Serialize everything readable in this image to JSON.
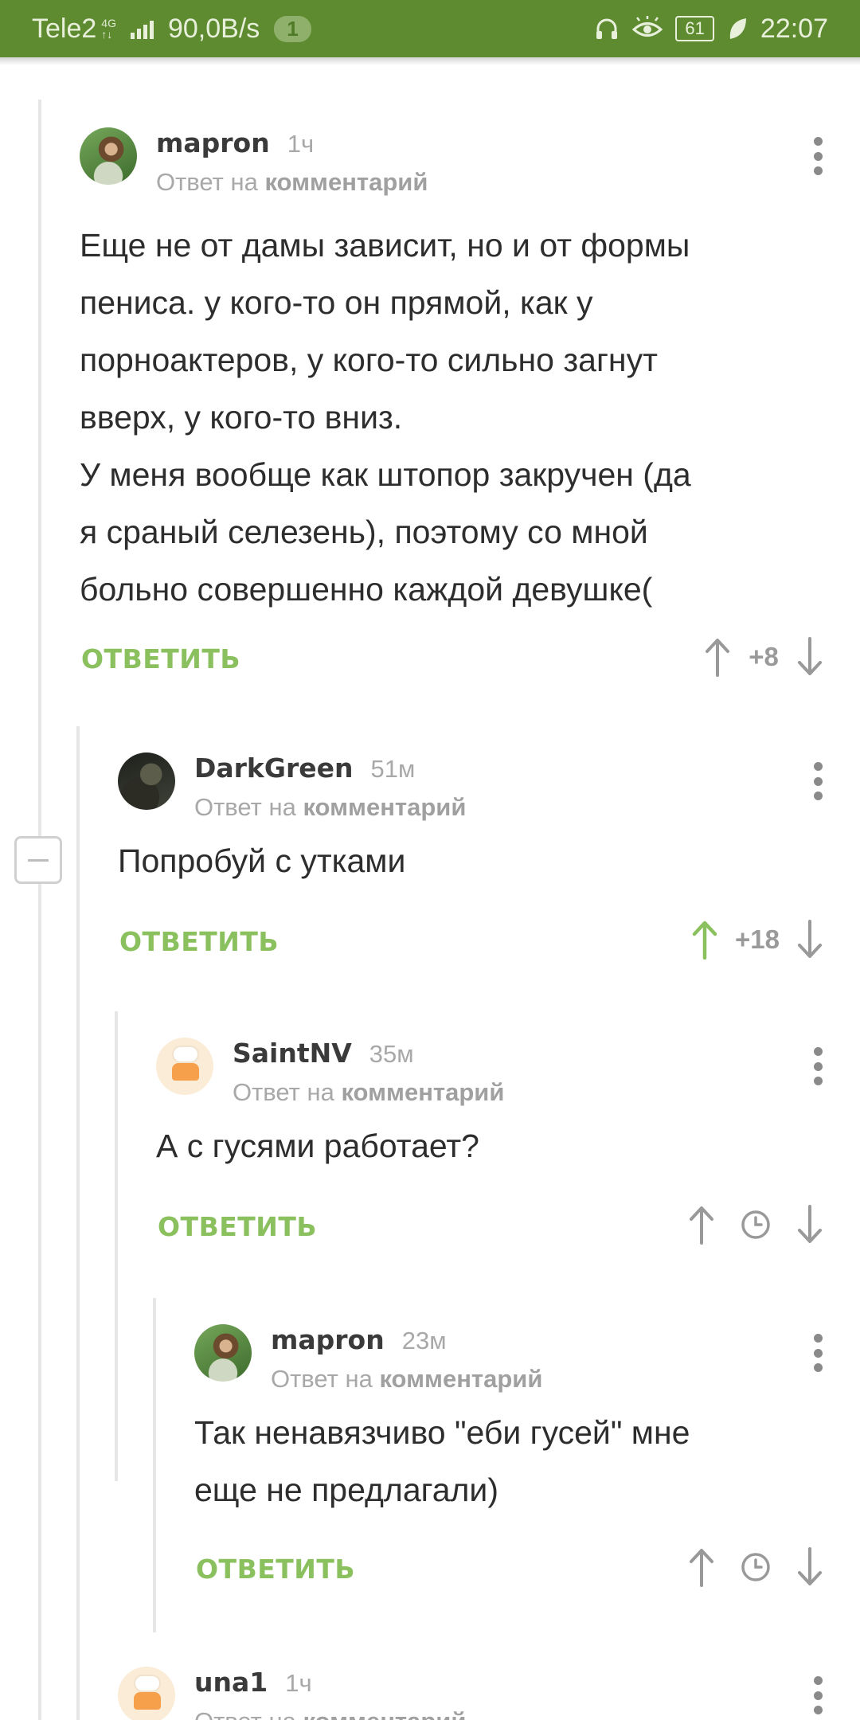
{
  "status_bar": {
    "carrier": "Tele2",
    "network_top": "4G",
    "network_bottom": "↑↓",
    "speed": "90,0B/s",
    "notifications": "1",
    "battery": "61",
    "time": "22:07",
    "bar_color": "#5e8b30"
  },
  "accent_color": "#8bc05f",
  "comments": [
    {
      "username": "mapron",
      "time": "1ч",
      "reply_prefix": "Ответ на",
      "reply_link": "комментарий",
      "body": [
        "Еще не от дамы зависит, но и от формы",
        "пениса. у кого-то он прямой, как у",
        "порноактеров, у кого-то сильно загнут",
        "вверх, у кого-то вниз.",
        "У меня вообще как штопор закручен (да",
        "я сраный селезень), поэтому со мной",
        "больно совершенно каждой девушке("
      ],
      "reply_label": "ОТВЕТИТЬ",
      "score": "+8"
    },
    {
      "username": "DarkGreen",
      "time": "51м",
      "reply_prefix": "Ответ на",
      "reply_link": "комментарий",
      "body": [
        "Попробуй с утками"
      ],
      "reply_label": "ОТВЕТИТЬ",
      "score": "+18",
      "upvoted": true
    },
    {
      "username": "SaintNV",
      "time": "35м",
      "reply_prefix": "Ответ на",
      "reply_link": "комментарий",
      "body": [
        "А с гусями работает?"
      ],
      "reply_label": "ОТВЕТИТЬ",
      "score_icon": "clock-icon"
    },
    {
      "username": "mapron",
      "time": "23м",
      "reply_prefix": "Ответ на",
      "reply_link": "комментарий",
      "body": [
        "Так ненавязчиво \"еби гусей\" мне",
        "еще не предлагали)"
      ],
      "reply_label": "ОТВЕТИТЬ",
      "score_icon": "clock-icon"
    },
    {
      "username": "una1",
      "time": "1ч",
      "reply_prefix": "Ответ на",
      "reply_link": "комментарий"
    }
  ]
}
